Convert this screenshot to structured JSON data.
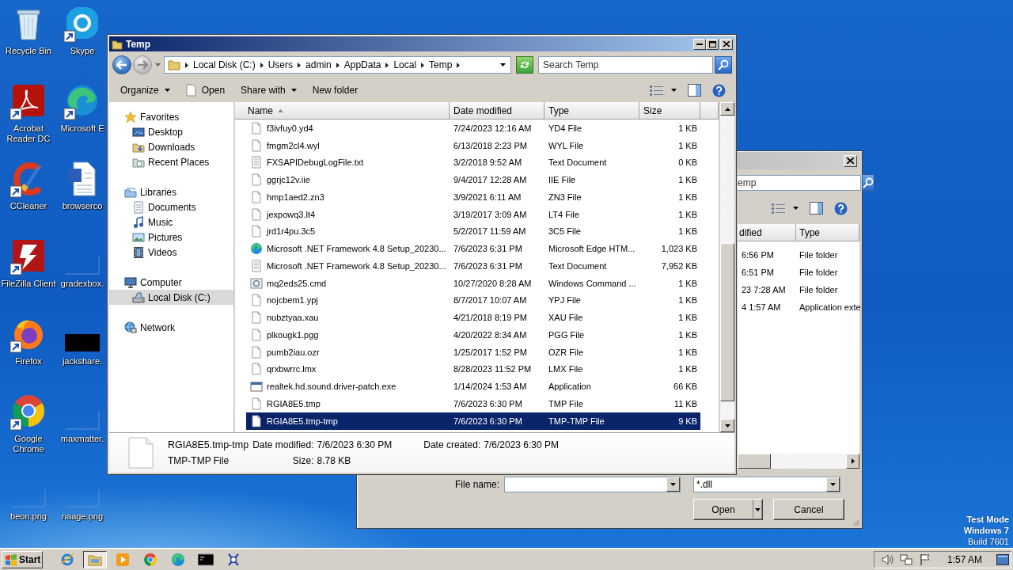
{
  "desktop": {
    "icons": [
      {
        "label": "Recycle Bin",
        "kind": "recycle",
        "shortcut": false
      },
      {
        "label": "Skype",
        "kind": "skype",
        "shortcut": true
      },
      {
        "label": "Acrobat Reader DC",
        "kind": "acrobat",
        "shortcut": true
      },
      {
        "label": "Microsoft E",
        "kind": "edge",
        "shortcut": true
      },
      {
        "label": "CCleaner",
        "kind": "ccleaner",
        "shortcut": true
      },
      {
        "label": "browserco",
        "kind": "word",
        "shortcut": false
      },
      {
        "label": "FileZilla Client",
        "kind": "filezilla",
        "shortcut": true
      },
      {
        "label": "gradexbox.",
        "kind": "blank",
        "shortcut": false
      },
      {
        "label": "Firefox",
        "kind": "firefox",
        "shortcut": true
      },
      {
        "label": "jackshare.",
        "kind": "black",
        "shortcut": false
      },
      {
        "label": "Google Chrome",
        "kind": "chrome",
        "shortcut": true
      },
      {
        "label": "maxmatter.",
        "kind": "blank",
        "shortcut": false
      },
      {
        "label": "beon.png",
        "kind": "blank",
        "shortcut": false
      },
      {
        "label": "naage.png",
        "kind": "blank",
        "shortcut": false
      }
    ],
    "notice": [
      "Test Mode",
      "Windows 7",
      "Build 7601"
    ]
  },
  "explorer": {
    "title": "Temp",
    "breadcrumb": [
      "Local Disk (C:)",
      "Users",
      "admin",
      "AppData",
      "Local",
      "Temp"
    ],
    "search": {
      "placeholder": "Search Temp"
    },
    "toolbar": [
      {
        "label": "Organize",
        "kind": "menu"
      },
      {
        "label": "Open",
        "kind": "open"
      },
      {
        "label": "Share with",
        "kind": "menu"
      },
      {
        "label": "New folder",
        "kind": "plain"
      }
    ],
    "nav": [
      {
        "label": "Favorites",
        "kind": "star",
        "selected": false,
        "children": [
          {
            "label": "Desktop",
            "kind": "desktop",
            "selected": false
          },
          {
            "label": "Downloads",
            "kind": "downloads",
            "selected": false
          },
          {
            "label": "Recent Places",
            "kind": "recent",
            "selected": false
          }
        ]
      },
      {
        "label": "Libraries",
        "kind": "library",
        "selected": false,
        "children": [
          {
            "label": "Documents",
            "kind": "documents",
            "selected": false
          },
          {
            "label": "Music",
            "kind": "music",
            "selected": false
          },
          {
            "label": "Pictures",
            "kind": "pictures",
            "selected": false
          },
          {
            "label": "Videos",
            "kind": "videos",
            "selected": false
          }
        ]
      },
      {
        "label": "Computer",
        "kind": "computer",
        "selected": false,
        "children": [
          {
            "label": "Local Disk (C:)",
            "kind": "disk",
            "selected": true
          }
        ]
      },
      {
        "label": "Network",
        "kind": "network",
        "selected": false
      }
    ],
    "columns": [
      {
        "label": "Name",
        "sorted": true
      },
      {
        "label": "Date modified",
        "sorted": false
      },
      {
        "label": "Type",
        "sorted": false
      },
      {
        "label": "Size",
        "sorted": false
      }
    ],
    "rows": [
      {
        "name": "f3ivfuy0.yd4",
        "date": "7/24/2023 12:16 AM",
        "type": "YD4 File",
        "size": "1 KB",
        "kind": "file",
        "selected": false
      },
      {
        "name": "fmgm2cl4.wyl",
        "date": "6/13/2018 2:23 PM",
        "type": "WYL File",
        "size": "1 KB",
        "kind": "file",
        "selected": false
      },
      {
        "name": "FXSAPIDebugLogFile.txt",
        "date": "3/2/2018 9:52 AM",
        "type": "Text Document",
        "size": "0 KB",
        "kind": "text",
        "selected": false
      },
      {
        "name": "ggrjc12v.iie",
        "date": "9/4/2017 12:28 AM",
        "type": "IIE File",
        "size": "1 KB",
        "kind": "file",
        "selected": false
      },
      {
        "name": "hmp1aed2.zn3",
        "date": "3/9/2021 6:11 AM",
        "type": "ZN3 File",
        "size": "1 KB",
        "kind": "file",
        "selected": false
      },
      {
        "name": "jexpowq3.lt4",
        "date": "3/19/2017 3:09 AM",
        "type": "LT4 File",
        "size": "1 KB",
        "kind": "file",
        "selected": false
      },
      {
        "name": "jrd1r4pu.3c5",
        "date": "5/2/2017 11:59 AM",
        "type": "3C5 File",
        "size": "1 KB",
        "kind": "file",
        "selected": false
      },
      {
        "name": "Microsoft .NET Framework 4.8 Setup_20230...",
        "date": "7/6/2023 6:31 PM",
        "type": "Microsoft Edge HTM...",
        "size": "1,023 KB",
        "kind": "web",
        "selected": false
      },
      {
        "name": "Microsoft .NET Framework 4.8 Setup_20230...",
        "date": "7/6/2023 6:31 PM",
        "type": "Text Document",
        "size": "7,952 KB",
        "kind": "text",
        "selected": false
      },
      {
        "name": "mq2eds25.cmd",
        "date": "10/27/2020 8:28 AM",
        "type": "Windows Command ...",
        "size": "1 KB",
        "kind": "script",
        "selected": false
      },
      {
        "name": "nojcbem1.ypj",
        "date": "8/7/2017 10:07 AM",
        "type": "YPJ File",
        "size": "1 KB",
        "kind": "file",
        "selected": false
      },
      {
        "name": "nubztyaa.xau",
        "date": "4/21/2018 8:19 PM",
        "type": "XAU File",
        "size": "1 KB",
        "kind": "file",
        "selected": false
      },
      {
        "name": "plkougk1.pgg",
        "date": "4/20/2022 8:34 AM",
        "type": "PGG File",
        "size": "1 KB",
        "kind": "file",
        "selected": false
      },
      {
        "name": "pumb2iau.ozr",
        "date": "1/25/2017 1:52 PM",
        "type": "OZR File",
        "size": "1 KB",
        "kind": "file",
        "selected": false
      },
      {
        "name": "qrxbwrrc.lmx",
        "date": "8/28/2023 11:52 PM",
        "type": "LMX File",
        "size": "1 KB",
        "kind": "file",
        "selected": false
      },
      {
        "name": "realtek.hd.sound.driver-patch.exe",
        "date": "1/14/2024 1:53 AM",
        "type": "Application",
        "size": "66 KB",
        "kind": "app",
        "selected": false
      },
      {
        "name": "RGIA8E5.tmp",
        "date": "7/6/2023 6:30 PM",
        "type": "TMP File",
        "size": "11 KB",
        "kind": "file",
        "selected": false
      },
      {
        "name": "RGIA8E5.tmp-tmp",
        "date": "7/6/2023 6:30 PM",
        "type": "TMP-TMP File",
        "size": "9 KB",
        "kind": "file",
        "selected": true
      }
    ],
    "details": {
      "name": "RGIA8E5.tmp-tmp",
      "type": "TMP-TMP File",
      "fields": [
        {
          "label": "Date modified:",
          "value": "7/6/2023 6:30 PM"
        },
        {
          "label": "Date created:",
          "value": "7/6/2023 6:30 PM"
        },
        {
          "label": "Size:",
          "value": "8.78 KB"
        }
      ]
    }
  },
  "dialog": {
    "search": {
      "placeholder": "emp"
    },
    "columns": [
      "dified",
      "Type"
    ],
    "rows": [
      {
        "date": "6:56 PM",
        "type": "File folder"
      },
      {
        "date": "6:51 PM",
        "type": "File folder"
      },
      {
        "date": "23 7:28 AM",
        "type": "File folder"
      },
      {
        "date": "4 1:57 AM",
        "type": "Application exte"
      }
    ],
    "file_name": {
      "label": "File name:"
    },
    "filter": {
      "value": "*.dll"
    },
    "buttons": [
      {
        "label": "Open",
        "kind": "split"
      },
      {
        "label": "Cancel",
        "kind": "plain"
      }
    ]
  },
  "taskbar": {
    "start": "Start",
    "apps": [
      {
        "kind": "ie",
        "active": false
      },
      {
        "kind": "explorer",
        "active": true
      },
      {
        "kind": "media",
        "active": false
      },
      {
        "kind": "chrome",
        "active": false
      },
      {
        "kind": "edge",
        "active": false
      },
      {
        "kind": "cmd",
        "active": false
      },
      {
        "kind": "tool",
        "active": false
      }
    ],
    "clock": "1:57 AM"
  }
}
